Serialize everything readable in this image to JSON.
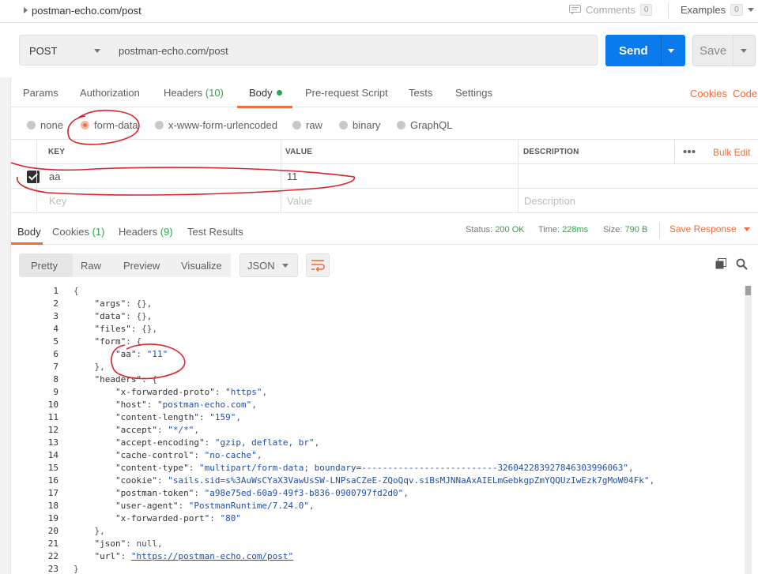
{
  "top": {
    "breadcrumb": "postman-echo.com/post",
    "comments_label": "Comments",
    "comments_count": "0",
    "examples_label": "Examples",
    "examples_count": "0"
  },
  "request": {
    "method": "POST",
    "url": "postman-echo.com/post",
    "send_label": "Send",
    "save_label": "Save"
  },
  "req_tabs": {
    "params": "Params",
    "authorization": "Authorization",
    "headers": "Headers",
    "headers_count": "(10)",
    "body": "Body",
    "prerequest": "Pre-request Script",
    "tests": "Tests",
    "settings": "Settings",
    "cookies": "Cookies",
    "code": "Code"
  },
  "body_types": [
    "none",
    "form-data",
    "x-www-form-urlencoded",
    "raw",
    "binary",
    "GraphQL"
  ],
  "kv_table": {
    "headers": {
      "key": "KEY",
      "value": "VALUE",
      "description": "DESCRIPTION"
    },
    "bulk_edit": "Bulk Edit",
    "rows": [
      {
        "key": "aa",
        "value": "11",
        "description": ""
      }
    ],
    "placeholders": {
      "key": "Key",
      "value": "Value",
      "description": "Description"
    }
  },
  "response_tabs": {
    "body": "Body",
    "cookies": "Cookies",
    "cookies_count": "(1)",
    "headers": "Headers",
    "headers_count": "(9)",
    "test_results": "Test Results"
  },
  "status": {
    "status_label": "Status:",
    "status_value": "200 OK",
    "time_label": "Time:",
    "time_value": "228ms",
    "size_label": "Size:",
    "size_value": "790 B",
    "save_response": "Save Response"
  },
  "format": {
    "pretty": "Pretty",
    "raw": "Raw",
    "preview": "Preview",
    "visualize": "Visualize",
    "language": "JSON"
  },
  "code_lines": [
    "{",
    "    \"args\": {},",
    "    \"data\": {},",
    "    \"files\": {},",
    "    \"form\": {",
    "        \"aa\": \"11\"",
    "    },",
    "    \"headers\": {",
    "        \"x-forwarded-proto\": \"https\",",
    "        \"host\": \"postman-echo.com\",",
    "        \"content-length\": \"159\",",
    "        \"accept\": \"*/*\",",
    "        \"accept-encoding\": \"gzip, deflate, br\",",
    "        \"cache-control\": \"no-cache\",",
    "        \"content-type\": \"multipart/form-data; boundary=--------------------------326042283927846303996063\",",
    "        \"cookie\": \"sails.sid=s%3AuWsCYaX3VawUsSW-LNPsaCZeE-ZQoQqv.siBsMJNNaAxAIELmGebkgpZmYQQUzIwEzk7gMoW04Fk\",",
    "        \"postman-token\": \"a98e75ed-60a9-49f3-b836-0900797fd2d0\",",
    "        \"user-agent\": \"PostmanRuntime/7.24.0\",",
    "        \"x-forwarded-port\": \"80\"",
    "    },",
    "    \"json\": null,",
    "    \"url\": \"https://postman-echo.com/post\"",
    "}"
  ],
  "colors": {
    "accent": "#f26b3a",
    "send": "#097bed",
    "green": "#2ca54a",
    "annotation": "#d9242b"
  }
}
